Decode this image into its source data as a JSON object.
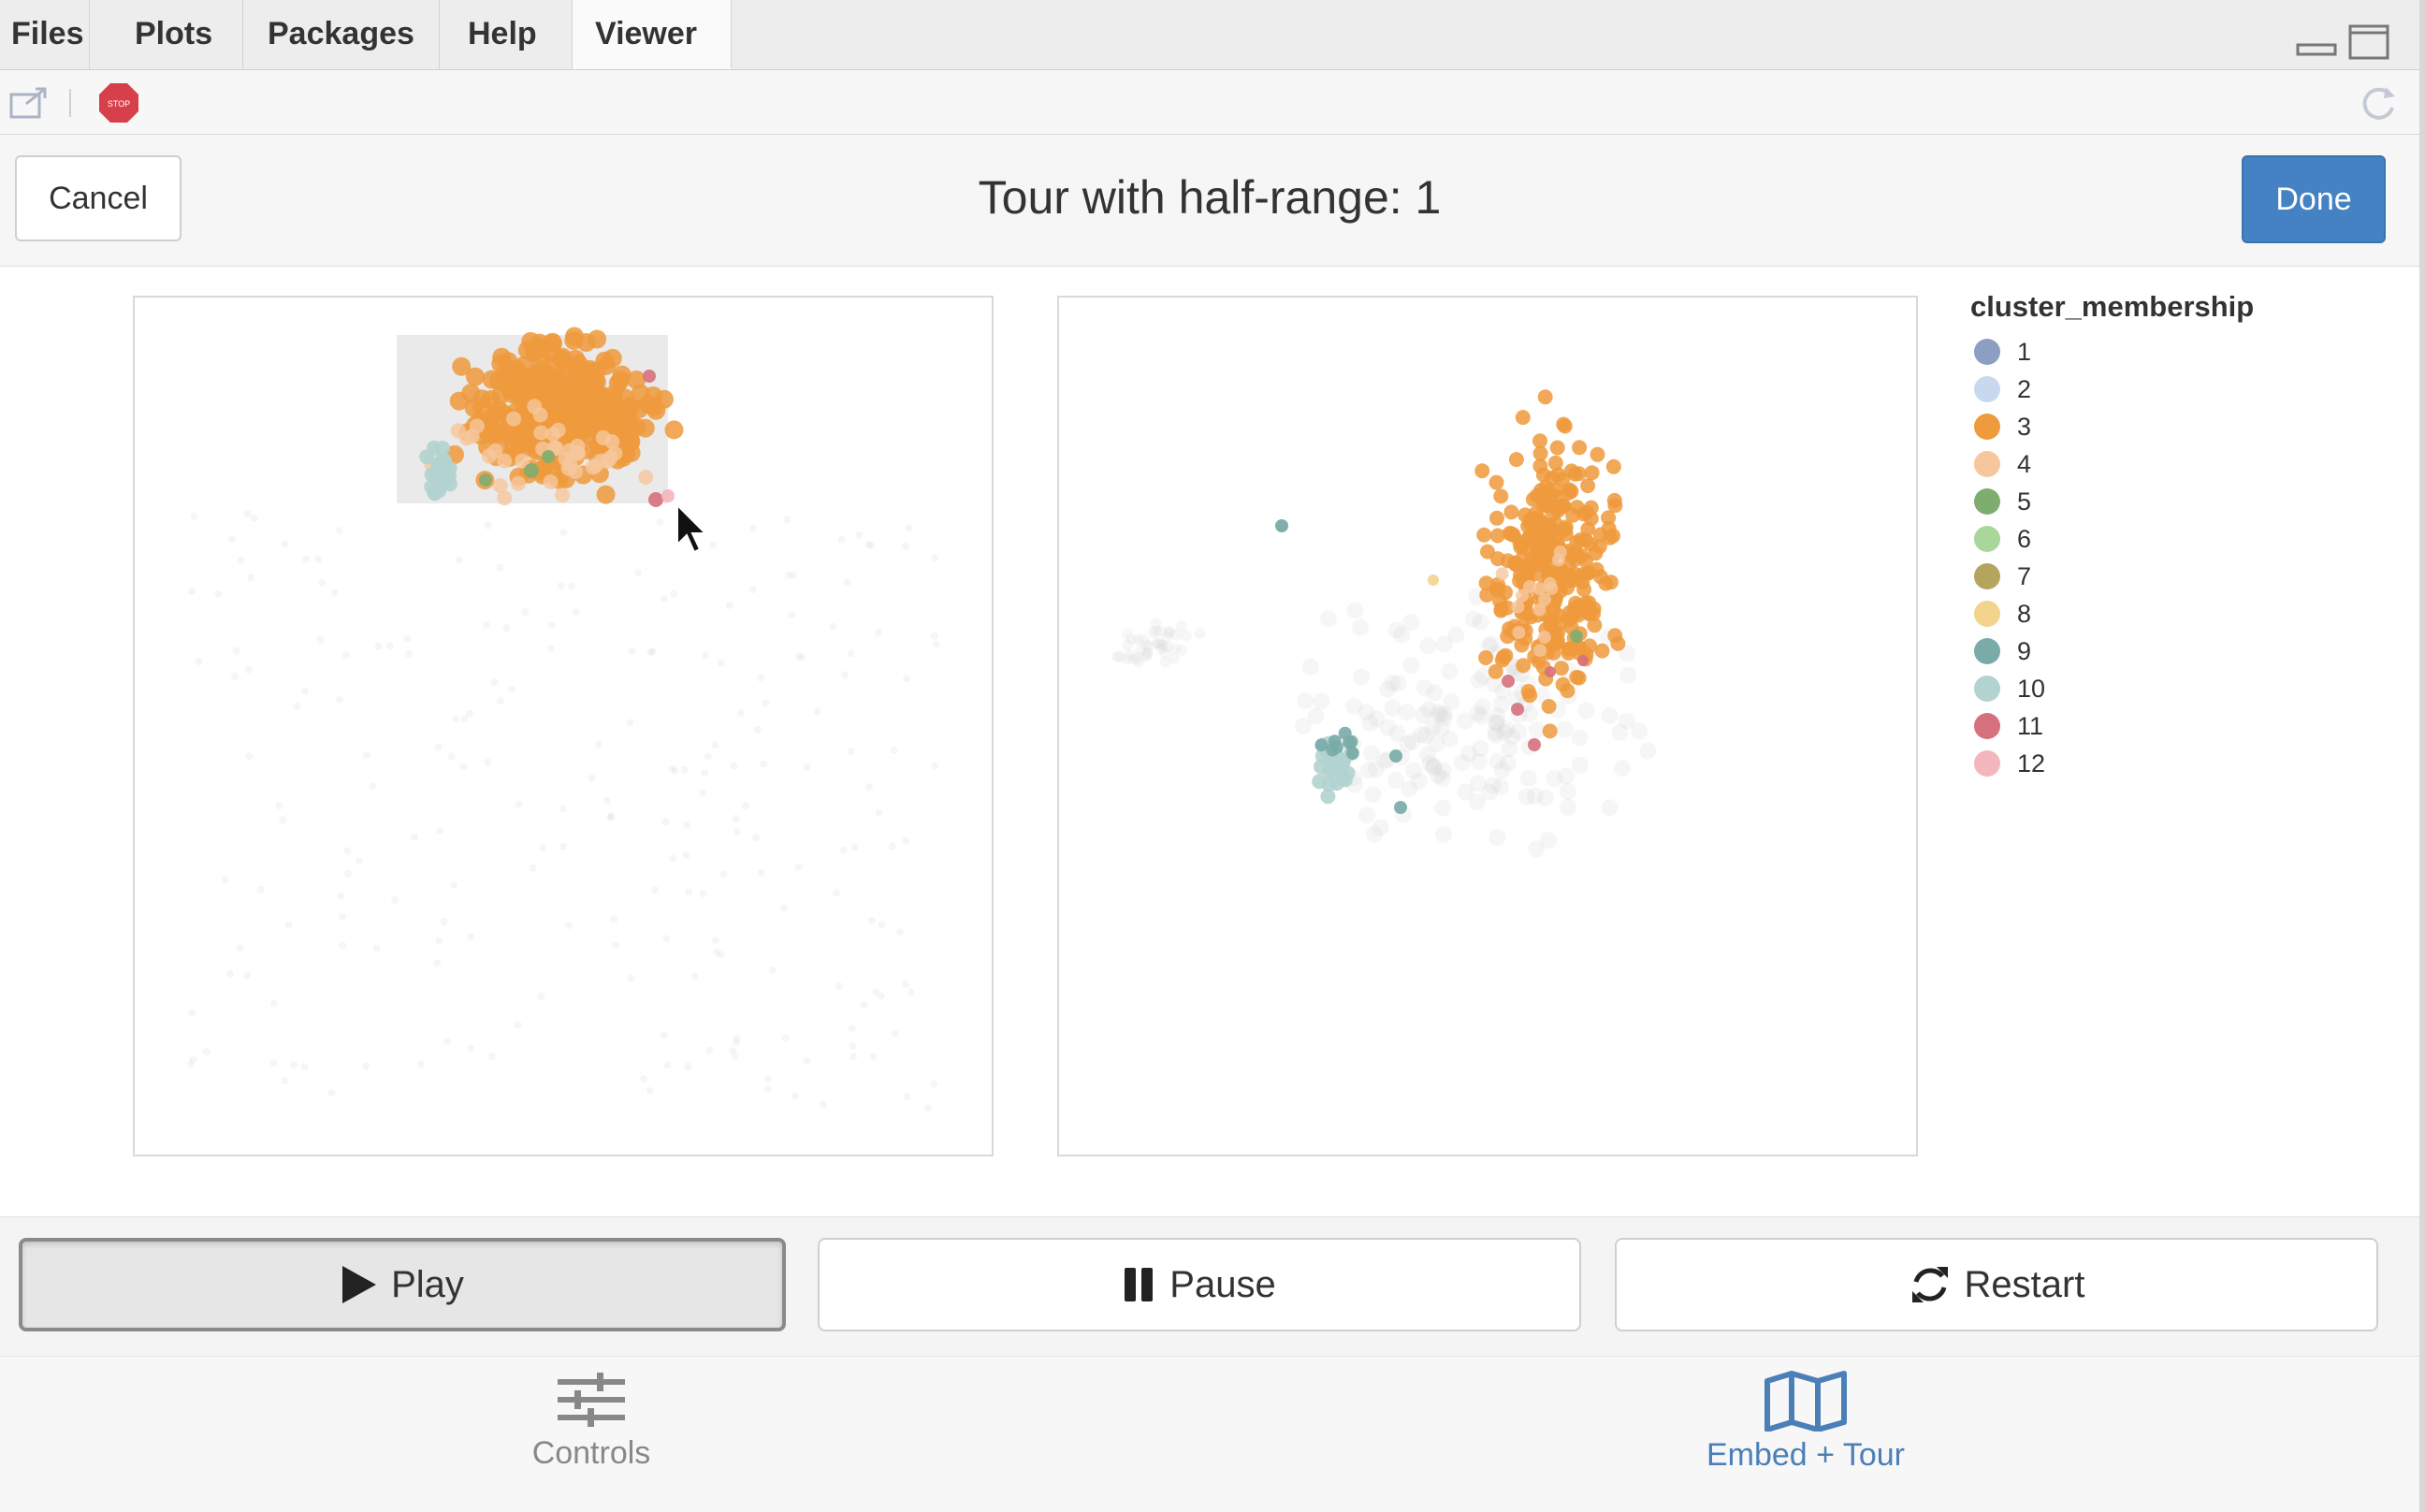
{
  "tabs": [
    {
      "label": "Files"
    },
    {
      "label": "Plots"
    },
    {
      "label": "Packages"
    },
    {
      "label": "Help"
    },
    {
      "label": "Viewer",
      "active": true
    }
  ],
  "header": {
    "cancel_label": "Cancel",
    "title": "Tour with half-range: 1",
    "done_label": "Done"
  },
  "legend": {
    "title": "cluster_membership",
    "items": [
      {
        "label": "1",
        "color": "#8c9fc2"
      },
      {
        "label": "2",
        "color": "#c7d8ef"
      },
      {
        "label": "3",
        "color": "#ef9a3c"
      },
      {
        "label": "4",
        "color": "#f6c79c"
      },
      {
        "label": "5",
        "color": "#7fad70"
      },
      {
        "label": "6",
        "color": "#a9d69a"
      },
      {
        "label": "7",
        "color": "#b4a45e"
      },
      {
        "label": "8",
        "color": "#f2d48c"
      },
      {
        "label": "9",
        "color": "#79aba7"
      },
      {
        "label": "10",
        "color": "#b2d3cf"
      },
      {
        "label": "11",
        "color": "#d6707c"
      },
      {
        "label": "12",
        "color": "#f2b6bc"
      }
    ]
  },
  "controls": {
    "play_label": "Play",
    "pause_label": "Pause",
    "restart_label": "Restart"
  },
  "bottom_nav": {
    "controls_label": "Controls",
    "embed_label": "Embed + Tour"
  },
  "icons": {
    "stop": "stop-icon",
    "refresh": "refresh-icon",
    "play": "play-icon",
    "pause": "pause-icon",
    "restart": "restart-icon",
    "controls": "sliders-icon",
    "embed": "map-icon",
    "cursor": "mouse-cursor-icon"
  }
}
